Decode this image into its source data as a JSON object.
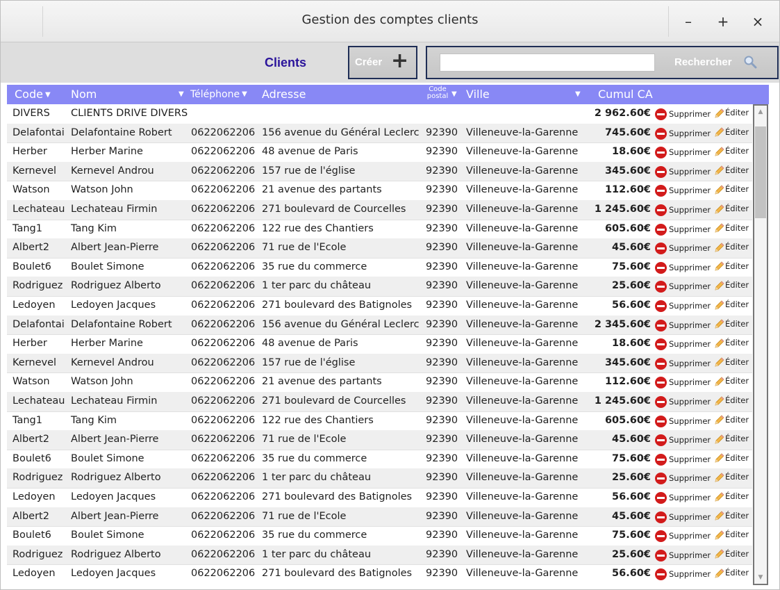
{
  "window": {
    "title": "Gestion des comptes clients",
    "buttons": {
      "minimize": "–",
      "maximize": "+",
      "close": "×"
    }
  },
  "toolbar": {
    "section_label": "Clients",
    "create_label": "Créer",
    "create_icon": "plus-icon",
    "search_value": "",
    "search_label": "Rechercher",
    "search_icon": "magnifier-icon"
  },
  "table": {
    "columns": {
      "code": "Code",
      "nom": "Nom",
      "telephone": "Téléphone",
      "adresse": "Adresse",
      "code_postal_line1": "Code",
      "code_postal_line2": "postal",
      "ville": "Ville",
      "cumul_ca": "Cumul CA"
    },
    "action_delete": "Supprimer",
    "action_edit": "Éditer",
    "rows": [
      {
        "code": "DIVERS",
        "nom": "CLIENTS DRIVE DIVERS",
        "tel": "",
        "adresse": "",
        "cp": "",
        "ville": "",
        "ca": "2 962.60€"
      },
      {
        "code": "Delafontai",
        "nom": "Delafontaine Robert",
        "tel": "0622062206",
        "adresse": "156 avenue du Général Leclerc",
        "cp": "92390",
        "ville": "Villeneuve-la-Garenne",
        "ca": "745.60€"
      },
      {
        "code": "Herber",
        "nom": "Herber Marine",
        "tel": "0622062206",
        "adresse": "48 avenue de Paris",
        "cp": "92390",
        "ville": "Villeneuve-la-Garenne",
        "ca": "18.60€"
      },
      {
        "code": "Kernevel",
        "nom": "Kernevel Androu",
        "tel": "0622062206",
        "adresse": "157 rue de l'église",
        "cp": "92390",
        "ville": "Villeneuve-la-Garenne",
        "ca": "345.60€"
      },
      {
        "code": "Watson",
        "nom": "Watson John",
        "tel": "0622062206",
        "adresse": "21 avenue des partants",
        "cp": "92390",
        "ville": "Villeneuve-la-Garenne",
        "ca": "112.60€"
      },
      {
        "code": "Lechateau",
        "nom": "Lechateau Firmin",
        "tel": "0622062206",
        "adresse": "271 boulevard de Courcelles",
        "cp": "92390",
        "ville": "Villeneuve-la-Garenne",
        "ca": "1 245.60€"
      },
      {
        "code": "Tang1",
        "nom": "Tang Kim",
        "tel": "0622062206",
        "adresse": "122 rue des Chantiers",
        "cp": "92390",
        "ville": "Villeneuve-la-Garenne",
        "ca": "605.60€"
      },
      {
        "code": "Albert2",
        "nom": "Albert Jean-Pierre",
        "tel": "0622062206",
        "adresse": "71 rue de l'Ecole",
        "cp": "92390",
        "ville": "Villeneuve-la-Garenne",
        "ca": "45.60€"
      },
      {
        "code": "Boulet6",
        "nom": "Boulet Simone",
        "tel": "0622062206",
        "adresse": "35 rue du commerce",
        "cp": "92390",
        "ville": "Villeneuve-la-Garenne",
        "ca": "75.60€"
      },
      {
        "code": "Rodriguez",
        "nom": "Rodriguez Alberto",
        "tel": "0622062206",
        "adresse": "1 ter parc du château",
        "cp": "92390",
        "ville": "Villeneuve-la-Garenne",
        "ca": "25.60€"
      },
      {
        "code": "Ledoyen",
        "nom": "Ledoyen Jacques",
        "tel": "0622062206",
        "adresse": "271 boulevard des Batignoles",
        "cp": "92390",
        "ville": "Villeneuve-la-Garenne",
        "ca": "56.60€"
      },
      {
        "code": "Delafontai",
        "nom": "Delafontaine Robert",
        "tel": "0622062206",
        "adresse": "156 avenue du Général Leclerc",
        "cp": "92390",
        "ville": "Villeneuve-la-Garenne",
        "ca": "2 345.60€"
      },
      {
        "code": "Herber",
        "nom": "Herber Marine",
        "tel": "0622062206",
        "adresse": "48 avenue de Paris",
        "cp": "92390",
        "ville": "Villeneuve-la-Garenne",
        "ca": "18.60€"
      },
      {
        "code": "Kernevel",
        "nom": "Kernevel Androu",
        "tel": "0622062206",
        "adresse": "157 rue de l'église",
        "cp": "92390",
        "ville": "Villeneuve-la-Garenne",
        "ca": "345.60€"
      },
      {
        "code": "Watson",
        "nom": "Watson John",
        "tel": "0622062206",
        "adresse": "21 avenue des partants",
        "cp": "92390",
        "ville": "Villeneuve-la-Garenne",
        "ca": "112.60€"
      },
      {
        "code": "Lechateau",
        "nom": "Lechateau Firmin",
        "tel": "0622062206",
        "adresse": "271 boulevard de Courcelles",
        "cp": "92390",
        "ville": "Villeneuve-la-Garenne",
        "ca": "1 245.60€"
      },
      {
        "code": "Tang1",
        "nom": "Tang Kim",
        "tel": "0622062206",
        "adresse": "122 rue des Chantiers",
        "cp": "92390",
        "ville": "Villeneuve-la-Garenne",
        "ca": "605.60€"
      },
      {
        "code": "Albert2",
        "nom": "Albert Jean-Pierre",
        "tel": "0622062206",
        "adresse": "71 rue de l'Ecole",
        "cp": "92390",
        "ville": "Villeneuve-la-Garenne",
        "ca": "45.60€"
      },
      {
        "code": "Boulet6",
        "nom": "Boulet Simone",
        "tel": "0622062206",
        "adresse": "35 rue du commerce",
        "cp": "92390",
        "ville": "Villeneuve-la-Garenne",
        "ca": "75.60€"
      },
      {
        "code": "Rodriguez",
        "nom": "Rodriguez Alberto",
        "tel": "0622062206",
        "adresse": "1 ter parc du château",
        "cp": "92390",
        "ville": "Villeneuve-la-Garenne",
        "ca": "25.60€"
      },
      {
        "code": "Ledoyen",
        "nom": "Ledoyen Jacques",
        "tel": "0622062206",
        "adresse": "271 boulevard des Batignoles",
        "cp": "92390",
        "ville": "Villeneuve-la-Garenne",
        "ca": "56.60€"
      },
      {
        "code": "Albert2",
        "nom": "Albert Jean-Pierre",
        "tel": "0622062206",
        "adresse": "71 rue de l'Ecole",
        "cp": "92390",
        "ville": "Villeneuve-la-Garenne",
        "ca": "45.60€"
      },
      {
        "code": "Boulet6",
        "nom": "Boulet Simone",
        "tel": "0622062206",
        "adresse": "35 rue du commerce",
        "cp": "92390",
        "ville": "Villeneuve-la-Garenne",
        "ca": "75.60€"
      },
      {
        "code": "Rodriguez",
        "nom": "Rodriguez Alberto",
        "tel": "0622062206",
        "adresse": "1 ter parc du château",
        "cp": "92390",
        "ville": "Villeneuve-la-Garenne",
        "ca": "25.60€"
      },
      {
        "code": "Ledoyen",
        "nom": "Ledoyen Jacques",
        "tel": "0622062206",
        "adresse": "271 boulevard des Batignoles",
        "cp": "92390",
        "ville": "Villeneuve-la-Garenne",
        "ca": "56.60€"
      }
    ]
  },
  "colors": {
    "header_bg": "#8888f5",
    "accent_border": "#1e2d55",
    "clients_label": "#2b149b",
    "delete_icon": "#d21b1b"
  },
  "icons": {
    "delete": "no-entry-icon",
    "edit": "pencil-icon",
    "sort": "sort-arrow-icon"
  }
}
